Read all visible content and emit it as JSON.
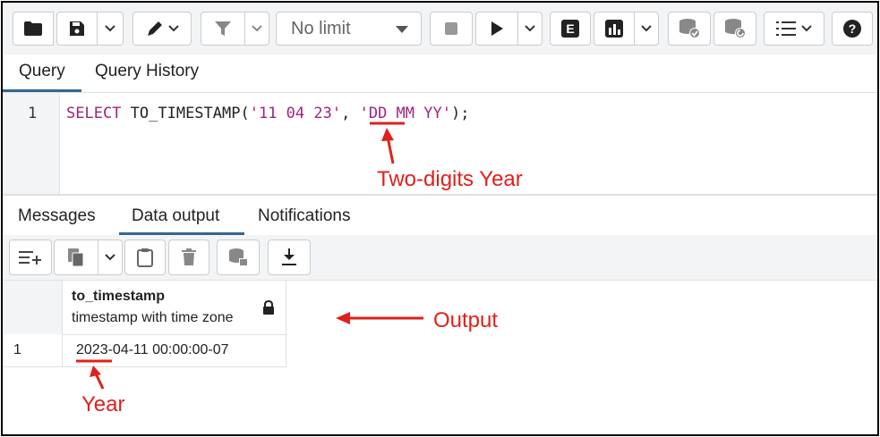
{
  "toolbar": {
    "limit_value": "No limit",
    "explain_label": "E"
  },
  "query_tabs": [
    {
      "label": "Query",
      "active": true
    },
    {
      "label": "Query History",
      "active": false
    }
  ],
  "editor": {
    "line_number": "1",
    "keyword": "SELECT",
    "function_open": " TO_TIMESTAMP(",
    "str1_a": "'11 04 ",
    "str1_year": "23",
    "str1_b": "'",
    "sep": ", ",
    "str2": "'DD MM YY'",
    "end": ");"
  },
  "result_tabs": [
    {
      "label": "Messages",
      "active": false
    },
    {
      "label": "Data output",
      "active": true
    },
    {
      "label": "Notifications",
      "active": false
    }
  ],
  "grid": {
    "column_name": "to_timestamp",
    "column_type": "timestamp with time zone",
    "rows": [
      {
        "num": "1",
        "value": "2023-04-11 00:00:00-07"
      }
    ]
  },
  "annotations": {
    "two_digit_year": "Two-digits Year",
    "output": "Output",
    "year": "Year"
  },
  "colors": {
    "accent": "#326690",
    "keyword": "#a0237f",
    "annotation": "#e0201b"
  }
}
